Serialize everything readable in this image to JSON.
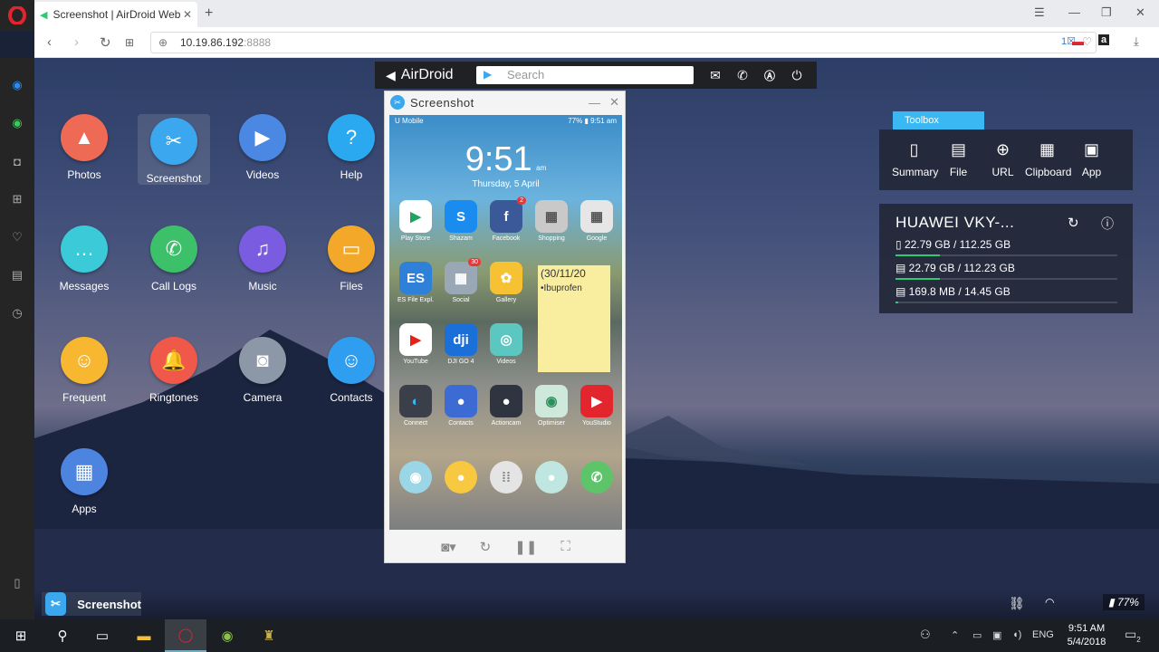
{
  "browser": {
    "tab_title": "Screenshot | AirDroid Web",
    "url_host": "10.19.86.192",
    "url_port": ":8888",
    "badge_count": "1"
  },
  "desktop_apps": [
    {
      "label": "Photos",
      "icon": "photos-icon",
      "color": "#ef6a54"
    },
    {
      "label": "Screenshot",
      "icon": "scissors-icon",
      "color": "#3aa7ef"
    },
    {
      "label": "Videos",
      "icon": "play-icon",
      "color": "#4a88e4"
    },
    {
      "label": "Help",
      "icon": "question-icon",
      "color": "#2aa9f0"
    },
    {
      "label": "Messages",
      "icon": "chat-icon",
      "color": "#3bcbd8"
    },
    {
      "label": "Call Logs",
      "icon": "phone-icon",
      "color": "#3cc06a"
    },
    {
      "label": "Music",
      "icon": "music-icon",
      "color": "#7a5ce0"
    },
    {
      "label": "Files",
      "icon": "folder-icon",
      "color": "#f4a82a"
    },
    {
      "label": "Frequent",
      "icon": "contact-card-icon",
      "color": "#f7b731"
    },
    {
      "label": "Ringtones",
      "icon": "bell-icon",
      "color": "#f0584a"
    },
    {
      "label": "Camera",
      "icon": "camera-icon",
      "color": "#8c97a8"
    },
    {
      "label": "Contacts",
      "icon": "contacts-icon",
      "color": "#2f9ef0"
    },
    {
      "label": "Apps",
      "icon": "grid-icon",
      "color": "#4c84e0"
    }
  ],
  "airdroid_bar": {
    "logo": "AirDroid",
    "search_placeholder": "Search"
  },
  "screenshot_window": {
    "title": "Screenshot",
    "phone": {
      "carrier": "U Mobile",
      "status_right": "77% ▮ 9:51 am",
      "clock": "9:51",
      "clock_ampm": "am",
      "date": "Thursday, 5 April",
      "apps": [
        {
          "label": "Play Store",
          "color": "#ffffff",
          "glyph": "▶",
          "fg": "#1ea362"
        },
        {
          "label": "Shazam",
          "color": "#1a8cf0",
          "glyph": "S",
          "fg": "#ffffff"
        },
        {
          "label": "Facebook",
          "color": "#3b5998",
          "glyph": "f",
          "fg": "#ffffff",
          "badge": "2"
        },
        {
          "label": "Shopping",
          "color": "#c9c9c9",
          "glyph": "▦",
          "fg": "#555"
        },
        {
          "label": "Google",
          "color": "#e6e6e6",
          "glyph": "▦",
          "fg": "#555"
        },
        {
          "label": "ES File Expl.",
          "color": "#2f80d8",
          "glyph": "ES",
          "fg": "#ffffff"
        },
        {
          "label": "Social",
          "color": "#9aa8b6",
          "glyph": "▦",
          "fg": "#fff",
          "badge": "30"
        },
        {
          "label": "Gallery",
          "color": "#f6c234",
          "glyph": "✿",
          "fg": "#ffffff"
        },
        {
          "label": "YouTube",
          "color": "#ffffff",
          "glyph": "▶",
          "fg": "#e62117"
        },
        {
          "label": "DJI GO 4",
          "color": "#1a6fd8",
          "glyph": "dji",
          "fg": "#ffffff"
        },
        {
          "label": "Videos",
          "color": "#5cc6c0",
          "glyph": "◎",
          "fg": "#ffffff"
        },
        {
          "label": "Connect",
          "color": "#3a3f4a",
          "glyph": "◐",
          "fg": "#3ab8f3"
        },
        {
          "label": "Contacts",
          "color": "#3d6bd4",
          "glyph": "●",
          "fg": "#ffffff"
        },
        {
          "label": "Actioncam",
          "color": "#2e3540",
          "glyph": "●",
          "fg": "#ffffff"
        },
        {
          "label": "Optimiser",
          "color": "#cfe8dc",
          "glyph": "◉",
          "fg": "#2c8f5c"
        },
        {
          "label": "YouStudio",
          "color": "#e3262e",
          "glyph": "▶",
          "fg": "#ffffff"
        }
      ],
      "dock": [
        {
          "label": "Camera",
          "color": "#9bd6e6",
          "glyph": "◉",
          "fg": "#fff"
        },
        {
          "label": "Messages",
          "color": "#f7c840",
          "glyph": "●",
          "fg": "#fff"
        },
        {
          "label": "Apps",
          "color": "#e4e4e4",
          "glyph": "⁞⁞",
          "fg": "#888"
        },
        {
          "label": "Browser",
          "color": "#bfe6e0",
          "glyph": "●",
          "fg": "#fff"
        },
        {
          "label": "Phone",
          "color": "#5dc46a",
          "glyph": "✆",
          "fg": "#fff"
        }
      ],
      "note_title": "(30/11/20",
      "note_item": "•Ibuprofen"
    }
  },
  "toolbox": {
    "label": "Toolbox",
    "tools": [
      "Summary",
      "File",
      "URL",
      "Clipboard",
      "App"
    ]
  },
  "device": {
    "name": "HUAWEI VKY-...",
    "storage": [
      {
        "text": "22.79 GB / 112.25 GB",
        "fill": 0.2
      },
      {
        "text": "22.79 GB / 112.23 GB",
        "fill": 0.2
      },
      {
        "text": "169.8 MB / 14.45 GB",
        "fill": 0.012
      }
    ]
  },
  "bottom_bar": {
    "task_label": "Screenshot",
    "battery": "77%"
  },
  "taskbar": {
    "lang": "ENG",
    "time": "9:51 AM",
    "date": "5/4/2018",
    "notif_count": "2"
  }
}
